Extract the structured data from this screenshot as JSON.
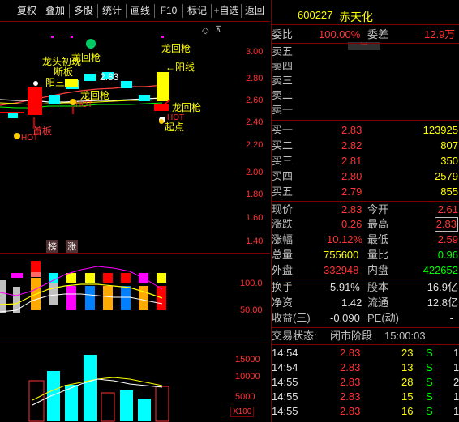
{
  "toolbar": {
    "buttons": [
      "复权",
      "叠加",
      "多股",
      "统计",
      "画线",
      "F10",
      "标记",
      "+自选",
      "返回"
    ]
  },
  "chart": {
    "price_axis": [
      "3.00",
      "2.80",
      "2.60",
      "2.40",
      "2.20",
      "2.00",
      "1.80",
      "1.60",
      "1.40"
    ],
    "indicator_axis": [
      "100.0",
      "50.00"
    ],
    "volume_axis": [
      "15000",
      "10000",
      "5000"
    ],
    "volume_unit": "X100",
    "annotations": {
      "longtou": "龙头初现",
      "duanban": "断板",
      "yangsan": "阳三",
      "hot1": "HOT",
      "hot2": "HOT",
      "hot3": "HOT",
      "longhuiqiang1": "龙回枪",
      "longhuiqiang2": "龙回枪",
      "longhuiqiang3": "龙回枪",
      "longhuiqiang4": "龙回枪",
      "yangxian": "←阳线",
      "shouban": "首板",
      "qidian": "起点",
      "price_283": "2.83",
      "bang": "榜",
      "zhang": "涨",
      "ban_label": "板"
    }
  },
  "quote": {
    "code": "600227",
    "name": "赤天化",
    "weibi_label": "委比",
    "weibi_value": "100.00%",
    "weicha_label": "委差",
    "weicha_value": "12.9万",
    "sell": [
      {
        "label": "卖五",
        "price": "",
        "vol": ""
      },
      {
        "label": "卖四",
        "price": "",
        "vol": ""
      },
      {
        "label": "卖三",
        "price": "",
        "vol": ""
      },
      {
        "label": "卖二",
        "price": "",
        "vol": ""
      },
      {
        "label": "卖一",
        "price": "",
        "vol": ""
      }
    ],
    "buy": [
      {
        "label": "买一",
        "price": "2.83",
        "vol": "123925"
      },
      {
        "label": "买二",
        "price": "2.82",
        "vol": "807"
      },
      {
        "label": "买三",
        "price": "2.81",
        "vol": "350"
      },
      {
        "label": "买四",
        "price": "2.80",
        "vol": "2579"
      },
      {
        "label": "买五",
        "price": "2.79",
        "vol": "855"
      }
    ],
    "stats": [
      {
        "l1": "现价",
        "v1": "2.83",
        "l2": "今开",
        "v2": "2.61"
      },
      {
        "l1": "涨跌",
        "v1": "0.26",
        "l2": "最高",
        "v2": "2.83"
      },
      {
        "l1": "涨幅",
        "v1": "10.12%",
        "l2": "最低",
        "v2": "2.59"
      },
      {
        "l1": "总量",
        "v1": "755600",
        "l2": "量比",
        "v2": "0.96"
      },
      {
        "l1": "外盘",
        "v1": "332948",
        "l2": "内盘",
        "v2": "422652"
      }
    ],
    "stats2": [
      {
        "l1": "换手",
        "v1": "5.91%",
        "l2": "股本",
        "v2": "16.9亿"
      },
      {
        "l1": "净资",
        "v1": "1.42",
        "l2": "流通",
        "v2": "12.8亿"
      },
      {
        "l1": "收益(三)",
        "v1": "-0.090",
        "l2": "PE(动)",
        "v2": "-"
      }
    ],
    "trade_status_label": "交易状态:",
    "trade_status": "闭市阶段",
    "trade_time": "15:00:03",
    "ticks": [
      {
        "time": "14:54",
        "price": "2.83",
        "vol": "23",
        "dir": "S",
        "n": "1"
      },
      {
        "time": "14:54",
        "price": "2.83",
        "vol": "13",
        "dir": "S",
        "n": "1"
      },
      {
        "time": "14:55",
        "price": "2.83",
        "vol": "28",
        "dir": "S",
        "n": "2"
      },
      {
        "time": "14:55",
        "price": "2.83",
        "vol": "15",
        "dir": "S",
        "n": "1"
      },
      {
        "time": "14:55",
        "price": "2.83",
        "vol": "16",
        "dir": "S",
        "n": "1"
      }
    ]
  }
}
